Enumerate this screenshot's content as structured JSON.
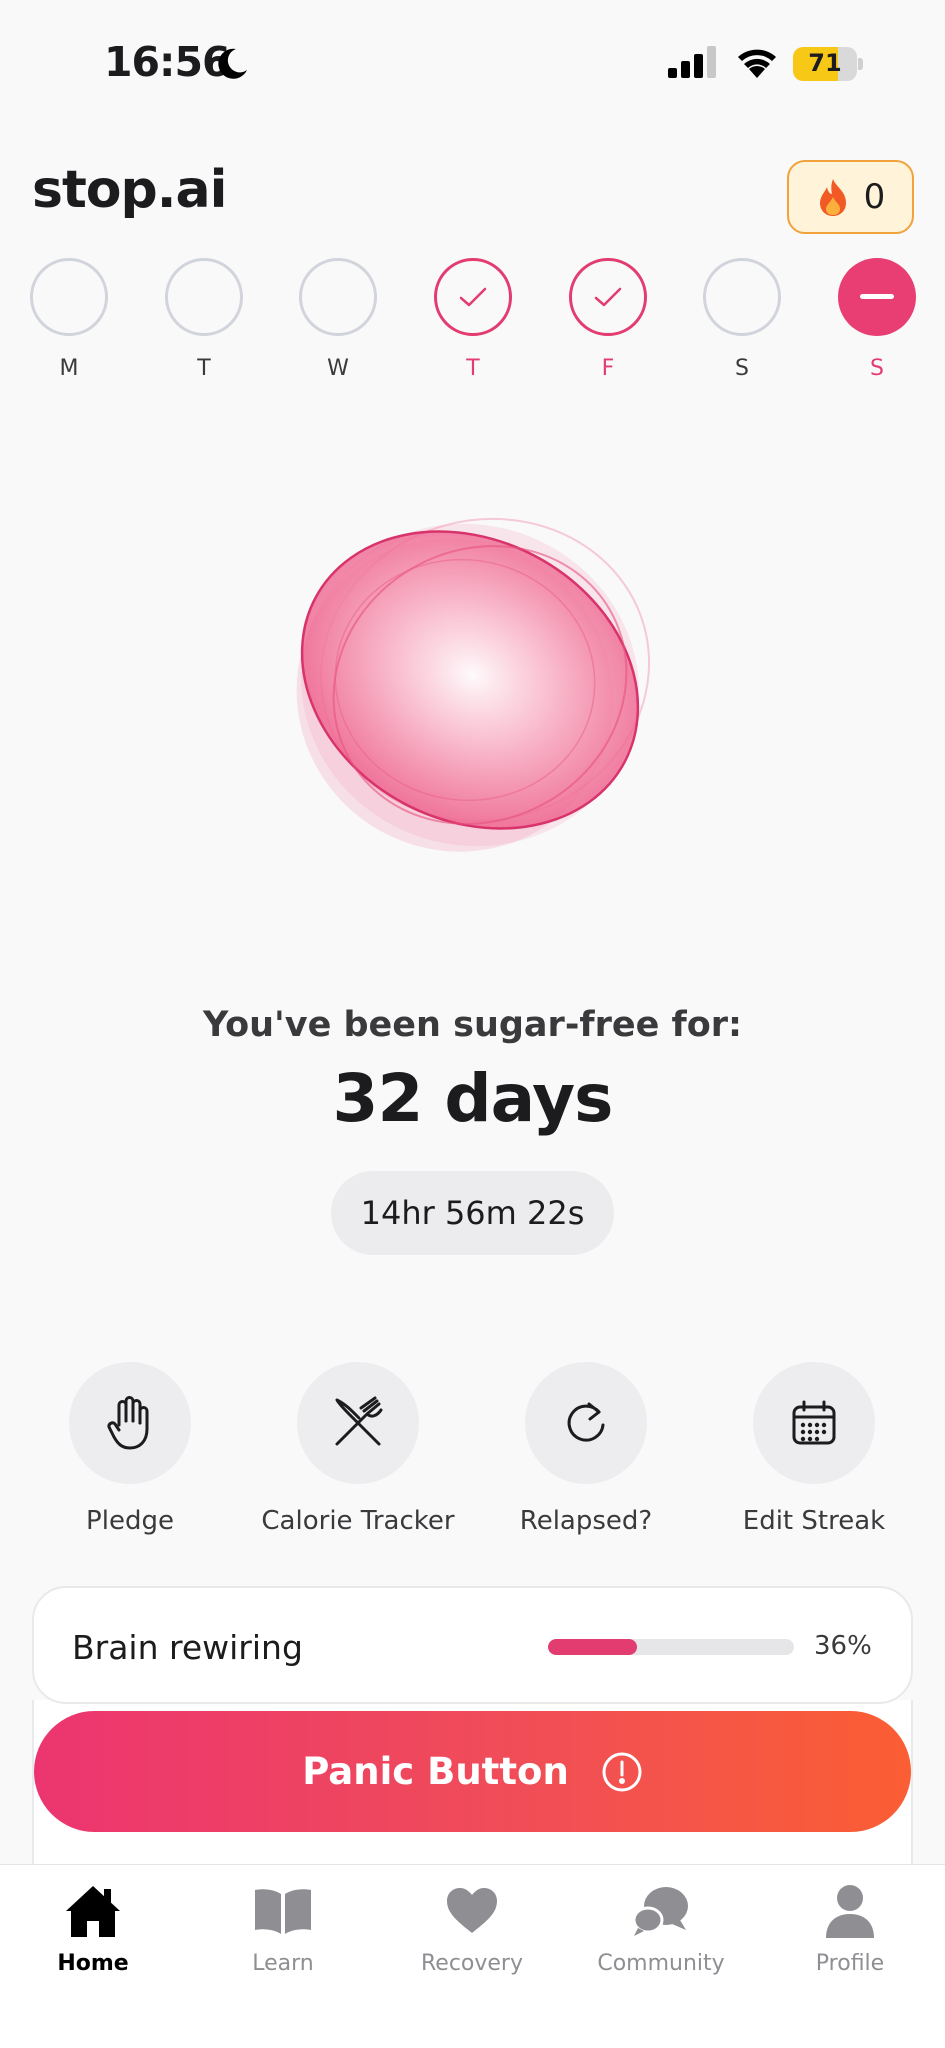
{
  "status_bar": {
    "time": "16:56",
    "battery": "71",
    "battery_level": 0.71,
    "icons": [
      "moon-icon",
      "signal-icon",
      "wifi-icon",
      "battery-icon"
    ]
  },
  "header": {
    "title": "stop.ai",
    "streak_count": "0",
    "streak_icon": "fire-icon"
  },
  "week": [
    {
      "letter": "M",
      "state": "empty"
    },
    {
      "letter": "T",
      "state": "empty"
    },
    {
      "letter": "W",
      "state": "empty"
    },
    {
      "letter": "T",
      "state": "done"
    },
    {
      "letter": "F",
      "state": "done"
    },
    {
      "letter": "S",
      "state": "empty"
    },
    {
      "letter": "S",
      "state": "today"
    }
  ],
  "counter": {
    "label": "You've been sugar-free for:",
    "days": "32 days",
    "timer": "14hr 56m 22s"
  },
  "actions": [
    {
      "label": "Pledge",
      "icon": "hand-icon"
    },
    {
      "label": "Calorie Tracker",
      "icon": "fork-knife-icon"
    },
    {
      "label": "Relapsed?",
      "icon": "refresh-icon"
    },
    {
      "label": "Edit Streak",
      "icon": "calendar-icon"
    }
  ],
  "brain_rewiring": {
    "title": "Brain rewiring",
    "percent_text": "36%",
    "progress": 0.36
  },
  "panic_button": {
    "label": "Panic Button",
    "icon": "alert-circle-icon"
  },
  "tabs": [
    {
      "label": "Home",
      "icon": "home-icon",
      "active": true
    },
    {
      "label": "Learn",
      "icon": "book-icon",
      "active": false
    },
    {
      "label": "Recovery",
      "icon": "heart-icon",
      "active": false
    },
    {
      "label": "Community",
      "icon": "chat-bubbles-icon",
      "active": false
    },
    {
      "label": "Profile",
      "icon": "person-icon",
      "active": false
    }
  ],
  "colors": {
    "accent": "#e83e73",
    "panic_start": "#ec3570",
    "panic_end": "#fb5e33",
    "streak_badge_bg": "#fff4d9",
    "streak_badge_border": "#f0a23b"
  }
}
